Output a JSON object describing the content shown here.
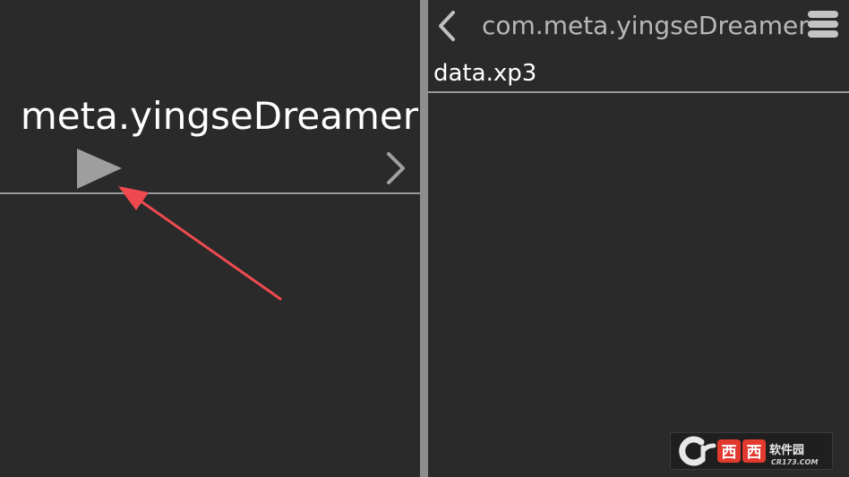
{
  "left_panel": {
    "title": "meta.yingseDreamer"
  },
  "right_panel": {
    "header_title": "com.meta.yingseDreamer",
    "files": [
      {
        "name": "data.xp3"
      }
    ]
  },
  "watermark": {
    "text": "西西软件园 CR173.COM"
  },
  "colors": {
    "background": "#2a2a2a",
    "splitter": "#8e8e8e",
    "divider": "#9a9a9a",
    "play_icon": "#9e9e9e",
    "annotation_arrow": "#ee4a4f",
    "header_text": "#b8b8b8"
  }
}
